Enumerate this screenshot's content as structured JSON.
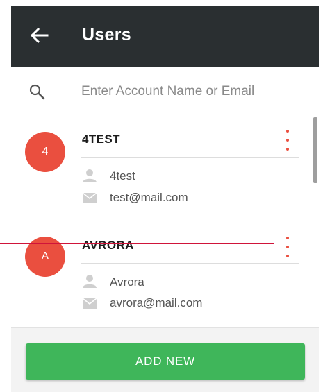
{
  "header": {
    "title": "Users",
    "back_icon": "arrow-left-icon",
    "background": "#2a2f31"
  },
  "search": {
    "placeholder": "Enter Account Name or Email",
    "value": "",
    "icon": "search-icon"
  },
  "users": [
    {
      "initial": "4",
      "name": "4TEST",
      "username": "4test",
      "email": "test@mail.com"
    },
    {
      "initial": "A",
      "name": "AVRORA",
      "username": "Avrora",
      "email": "avrora@mail.com"
    }
  ],
  "footer": {
    "add_label": "ADD NEW"
  },
  "colors": {
    "accent": "#ea4f3f",
    "button": "#3fb65a",
    "annotation_line": "#d0143a"
  }
}
